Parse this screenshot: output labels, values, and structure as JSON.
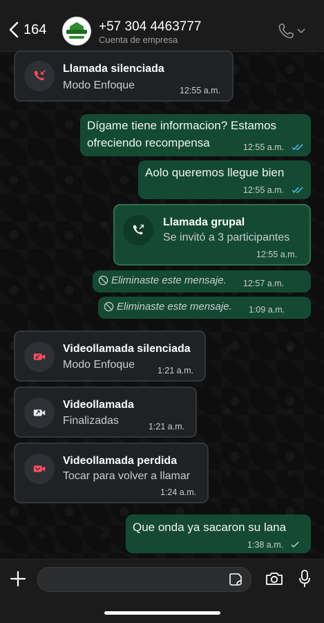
{
  "header": {
    "back_count": "164",
    "contact_name": "+57 304 4463777",
    "contact_subtitle": "Cuenta de empresa"
  },
  "messages": [
    {
      "kind": "call",
      "title": "Llamada silenciada",
      "subtitle": "Modo Enfoque",
      "time": "12:55 a.m.",
      "icon": "missed-call-icon",
      "icon_color": "#ff4d5e"
    },
    {
      "kind": "text",
      "lines": [
        "Dígame tiene informacion? Estamos",
        "ofreciendo recompensa"
      ],
      "time": "12:55 a.m.",
      "status": "read"
    },
    {
      "kind": "text",
      "lines": [
        "Aolo queremos llegue bien"
      ],
      "time": "12:55 a.m.",
      "status": "read"
    },
    {
      "kind": "call",
      "title": "Llamada grupal",
      "subtitle": "Se invitó a 3 participantes",
      "time": "12:55 a.m.",
      "icon": "outgoing-call-icon"
    },
    {
      "kind": "deleted",
      "text": "Eliminaste este mensaje.",
      "time": "12:57 a.m."
    },
    {
      "kind": "deleted",
      "text": "Eliminaste este mensaje.",
      "time": "1:09 a.m."
    },
    {
      "kind": "call",
      "title": "Videollamada silenciada",
      "subtitle": "Modo Enfoque",
      "time": "1:21 a.m.",
      "icon": "video-icon",
      "icon_color": "#ff4d5e"
    },
    {
      "kind": "call",
      "title": "Videollamada",
      "subtitle": "Finalizadas",
      "time": "1:21 a.m.",
      "icon": "video-icon"
    },
    {
      "kind": "call",
      "title": "Videollamada perdida",
      "subtitle": "Tocar para volver a llamar",
      "time": "1:24 a.m.",
      "icon": "video-icon",
      "icon_color": "#ff4d5e"
    },
    {
      "kind": "text",
      "lines": [
        "Que onda ya sacaron su lana"
      ],
      "time": "1:38 a.m.",
      "status": "delivered"
    }
  ],
  "colors": {
    "outgoing_bubble": "#144a34",
    "incoming_bubble": "#1f2225",
    "read_ticks": "#53bdeb",
    "missed": "#ff4d5e"
  }
}
